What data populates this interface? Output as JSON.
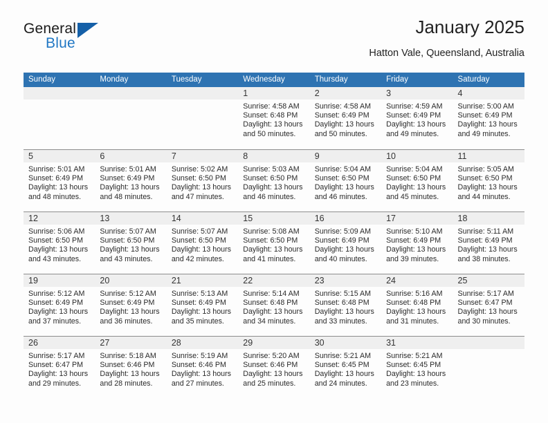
{
  "brand": {
    "name_top": "General",
    "name_bottom": "Blue",
    "triangle_color": "#1560a8",
    "blue_color": "#2077c4"
  },
  "header": {
    "title": "January 2025",
    "location": "Hatton Vale, Queensland, Australia"
  },
  "theme": {
    "header_blue": "#2e73b2",
    "datebar_gray": "#efefef",
    "rule_gray": "#8d8d8d"
  },
  "calendar": {
    "weekday_headers": [
      "Sunday",
      "Monday",
      "Tuesday",
      "Wednesday",
      "Thursday",
      "Friday",
      "Saturday"
    ],
    "weeks": [
      [
        {
          "day": "",
          "sunrise": "",
          "sunset": "",
          "daylight_1": "",
          "daylight_2": ""
        },
        {
          "day": "",
          "sunrise": "",
          "sunset": "",
          "daylight_1": "",
          "daylight_2": ""
        },
        {
          "day": "",
          "sunrise": "",
          "sunset": "",
          "daylight_1": "",
          "daylight_2": ""
        },
        {
          "day": "1",
          "sunrise": "Sunrise: 4:58 AM",
          "sunset": "Sunset: 6:48 PM",
          "daylight_1": "Daylight: 13 hours",
          "daylight_2": "and 50 minutes."
        },
        {
          "day": "2",
          "sunrise": "Sunrise: 4:58 AM",
          "sunset": "Sunset: 6:49 PM",
          "daylight_1": "Daylight: 13 hours",
          "daylight_2": "and 50 minutes."
        },
        {
          "day": "3",
          "sunrise": "Sunrise: 4:59 AM",
          "sunset": "Sunset: 6:49 PM",
          "daylight_1": "Daylight: 13 hours",
          "daylight_2": "and 49 minutes."
        },
        {
          "day": "4",
          "sunrise": "Sunrise: 5:00 AM",
          "sunset": "Sunset: 6:49 PM",
          "daylight_1": "Daylight: 13 hours",
          "daylight_2": "and 49 minutes."
        }
      ],
      [
        {
          "day": "5",
          "sunrise": "Sunrise: 5:01 AM",
          "sunset": "Sunset: 6:49 PM",
          "daylight_1": "Daylight: 13 hours",
          "daylight_2": "and 48 minutes."
        },
        {
          "day": "6",
          "sunrise": "Sunrise: 5:01 AM",
          "sunset": "Sunset: 6:49 PM",
          "daylight_1": "Daylight: 13 hours",
          "daylight_2": "and 48 minutes."
        },
        {
          "day": "7",
          "sunrise": "Sunrise: 5:02 AM",
          "sunset": "Sunset: 6:50 PM",
          "daylight_1": "Daylight: 13 hours",
          "daylight_2": "and 47 minutes."
        },
        {
          "day": "8",
          "sunrise": "Sunrise: 5:03 AM",
          "sunset": "Sunset: 6:50 PM",
          "daylight_1": "Daylight: 13 hours",
          "daylight_2": "and 46 minutes."
        },
        {
          "day": "9",
          "sunrise": "Sunrise: 5:04 AM",
          "sunset": "Sunset: 6:50 PM",
          "daylight_1": "Daylight: 13 hours",
          "daylight_2": "and 46 minutes."
        },
        {
          "day": "10",
          "sunrise": "Sunrise: 5:04 AM",
          "sunset": "Sunset: 6:50 PM",
          "daylight_1": "Daylight: 13 hours",
          "daylight_2": "and 45 minutes."
        },
        {
          "day": "11",
          "sunrise": "Sunrise: 5:05 AM",
          "sunset": "Sunset: 6:50 PM",
          "daylight_1": "Daylight: 13 hours",
          "daylight_2": "and 44 minutes."
        }
      ],
      [
        {
          "day": "12",
          "sunrise": "Sunrise: 5:06 AM",
          "sunset": "Sunset: 6:50 PM",
          "daylight_1": "Daylight: 13 hours",
          "daylight_2": "and 43 minutes."
        },
        {
          "day": "13",
          "sunrise": "Sunrise: 5:07 AM",
          "sunset": "Sunset: 6:50 PM",
          "daylight_1": "Daylight: 13 hours",
          "daylight_2": "and 43 minutes."
        },
        {
          "day": "14",
          "sunrise": "Sunrise: 5:07 AM",
          "sunset": "Sunset: 6:50 PM",
          "daylight_1": "Daylight: 13 hours",
          "daylight_2": "and 42 minutes."
        },
        {
          "day": "15",
          "sunrise": "Sunrise: 5:08 AM",
          "sunset": "Sunset: 6:50 PM",
          "daylight_1": "Daylight: 13 hours",
          "daylight_2": "and 41 minutes."
        },
        {
          "day": "16",
          "sunrise": "Sunrise: 5:09 AM",
          "sunset": "Sunset: 6:49 PM",
          "daylight_1": "Daylight: 13 hours",
          "daylight_2": "and 40 minutes."
        },
        {
          "day": "17",
          "sunrise": "Sunrise: 5:10 AM",
          "sunset": "Sunset: 6:49 PM",
          "daylight_1": "Daylight: 13 hours",
          "daylight_2": "and 39 minutes."
        },
        {
          "day": "18",
          "sunrise": "Sunrise: 5:11 AM",
          "sunset": "Sunset: 6:49 PM",
          "daylight_1": "Daylight: 13 hours",
          "daylight_2": "and 38 minutes."
        }
      ],
      [
        {
          "day": "19",
          "sunrise": "Sunrise: 5:12 AM",
          "sunset": "Sunset: 6:49 PM",
          "daylight_1": "Daylight: 13 hours",
          "daylight_2": "and 37 minutes."
        },
        {
          "day": "20",
          "sunrise": "Sunrise: 5:12 AM",
          "sunset": "Sunset: 6:49 PM",
          "daylight_1": "Daylight: 13 hours",
          "daylight_2": "and 36 minutes."
        },
        {
          "day": "21",
          "sunrise": "Sunrise: 5:13 AM",
          "sunset": "Sunset: 6:49 PM",
          "daylight_1": "Daylight: 13 hours",
          "daylight_2": "and 35 minutes."
        },
        {
          "day": "22",
          "sunrise": "Sunrise: 5:14 AM",
          "sunset": "Sunset: 6:48 PM",
          "daylight_1": "Daylight: 13 hours",
          "daylight_2": "and 34 minutes."
        },
        {
          "day": "23",
          "sunrise": "Sunrise: 5:15 AM",
          "sunset": "Sunset: 6:48 PM",
          "daylight_1": "Daylight: 13 hours",
          "daylight_2": "and 33 minutes."
        },
        {
          "day": "24",
          "sunrise": "Sunrise: 5:16 AM",
          "sunset": "Sunset: 6:48 PM",
          "daylight_1": "Daylight: 13 hours",
          "daylight_2": "and 31 minutes."
        },
        {
          "day": "25",
          "sunrise": "Sunrise: 5:17 AM",
          "sunset": "Sunset: 6:47 PM",
          "daylight_1": "Daylight: 13 hours",
          "daylight_2": "and 30 minutes."
        }
      ],
      [
        {
          "day": "26",
          "sunrise": "Sunrise: 5:17 AM",
          "sunset": "Sunset: 6:47 PM",
          "daylight_1": "Daylight: 13 hours",
          "daylight_2": "and 29 minutes."
        },
        {
          "day": "27",
          "sunrise": "Sunrise: 5:18 AM",
          "sunset": "Sunset: 6:46 PM",
          "daylight_1": "Daylight: 13 hours",
          "daylight_2": "and 28 minutes."
        },
        {
          "day": "28",
          "sunrise": "Sunrise: 5:19 AM",
          "sunset": "Sunset: 6:46 PM",
          "daylight_1": "Daylight: 13 hours",
          "daylight_2": "and 27 minutes."
        },
        {
          "day": "29",
          "sunrise": "Sunrise: 5:20 AM",
          "sunset": "Sunset: 6:46 PM",
          "daylight_1": "Daylight: 13 hours",
          "daylight_2": "and 25 minutes."
        },
        {
          "day": "30",
          "sunrise": "Sunrise: 5:21 AM",
          "sunset": "Sunset: 6:45 PM",
          "daylight_1": "Daylight: 13 hours",
          "daylight_2": "and 24 minutes."
        },
        {
          "day": "31",
          "sunrise": "Sunrise: 5:21 AM",
          "sunset": "Sunset: 6:45 PM",
          "daylight_1": "Daylight: 13 hours",
          "daylight_2": "and 23 minutes."
        },
        {
          "day": "",
          "sunrise": "",
          "sunset": "",
          "daylight_1": "",
          "daylight_2": ""
        }
      ]
    ]
  }
}
